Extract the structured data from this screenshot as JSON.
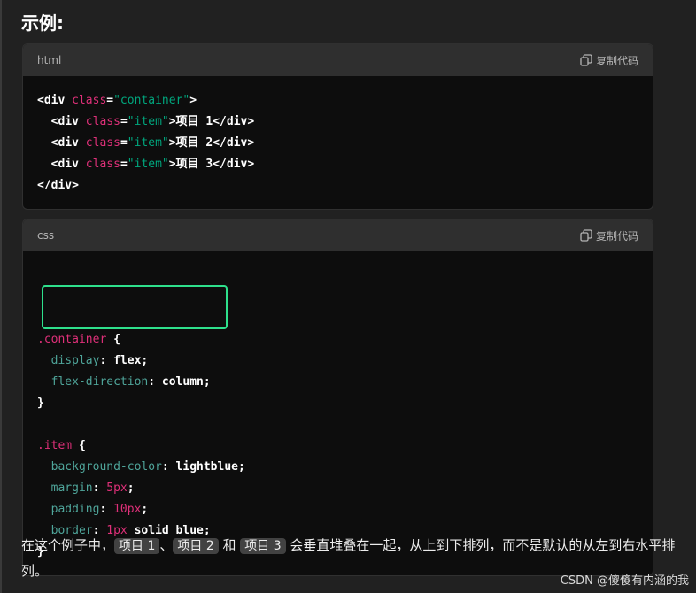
{
  "heading": "示例:",
  "code_blocks": [
    {
      "language": "html",
      "copy_label": "复制代码",
      "lines": [
        [
          [
            "tag",
            "<div "
          ],
          [
            "attr",
            "class"
          ],
          [
            "punc",
            "="
          ],
          [
            "str",
            "\"container\""
          ],
          [
            "tag",
            ">"
          ]
        ],
        [
          [
            "tag",
            "  <div "
          ],
          [
            "attr",
            "class"
          ],
          [
            "punc",
            "="
          ],
          [
            "str",
            "\"item\""
          ],
          [
            "tag",
            ">项目 1</div>"
          ]
        ],
        [
          [
            "tag",
            "  <div "
          ],
          [
            "attr",
            "class"
          ],
          [
            "punc",
            "="
          ],
          [
            "str",
            "\"item\""
          ],
          [
            "tag",
            ">项目 2</div>"
          ]
        ],
        [
          [
            "tag",
            "  <div "
          ],
          [
            "attr",
            "class"
          ],
          [
            "punc",
            "="
          ],
          [
            "str",
            "\"item\""
          ],
          [
            "tag",
            ">项目 3</div>"
          ]
        ],
        [
          [
            "tag",
            "</div>"
          ]
        ]
      ]
    },
    {
      "language": "css",
      "copy_label": "复制代码",
      "lines": [
        [
          [
            "sel",
            ".container"
          ],
          [
            "punc",
            " {"
          ]
        ],
        [
          [
            "prop",
            "  display"
          ],
          [
            "punc",
            ": "
          ],
          [
            "val",
            "flex"
          ],
          [
            "punc",
            ";"
          ]
        ],
        [
          [
            "prop",
            "  flex-direction"
          ],
          [
            "punc",
            ": "
          ],
          [
            "val",
            "column"
          ],
          [
            "punc",
            ";"
          ]
        ],
        [
          [
            "punc",
            "}"
          ]
        ],
        [
          [
            "punc",
            ""
          ]
        ],
        [
          [
            "sel",
            ".item"
          ],
          [
            "punc",
            " {"
          ]
        ],
        [
          [
            "prop",
            "  background-color"
          ],
          [
            "punc",
            ": "
          ],
          [
            "val",
            "lightblue"
          ],
          [
            "punc",
            ";"
          ]
        ],
        [
          [
            "prop",
            "  margin"
          ],
          [
            "punc",
            ": "
          ],
          [
            "num",
            "5px"
          ],
          [
            "punc",
            ";"
          ]
        ],
        [
          [
            "prop",
            "  padding"
          ],
          [
            "punc",
            ": "
          ],
          [
            "num",
            "10px"
          ],
          [
            "punc",
            ";"
          ]
        ],
        [
          [
            "prop",
            "  border"
          ],
          [
            "punc",
            ": "
          ],
          [
            "num",
            "1px"
          ],
          [
            "val",
            " solid blue"
          ],
          [
            "punc",
            ";"
          ]
        ],
        [
          [
            "punc",
            "}"
          ]
        ]
      ]
    }
  ],
  "paragraph": {
    "parts": [
      {
        "t": "text",
        "v": "在这个例子中，"
      },
      {
        "t": "code",
        "v": "项目 1"
      },
      {
        "t": "text",
        "v": "、"
      },
      {
        "t": "code",
        "v": "项目 2"
      },
      {
        "t": "text",
        "v": " 和 "
      },
      {
        "t": "code",
        "v": "项目 3"
      },
      {
        "t": "text",
        "v": " 会垂直堆叠在一起，从上到下排列，而不是默认的从左到右水平排列。"
      }
    ]
  },
  "watermark": "CSDN @傻傻有内涵的我",
  "colors": {
    "background": "#212121",
    "code_bg": "#0d0d0d",
    "header_bg": "#2f2f2f",
    "highlight": "#2ee08c",
    "keyword_pink": "#df3079",
    "string_green": "#00a67d",
    "property_teal": "#4fa59a"
  }
}
